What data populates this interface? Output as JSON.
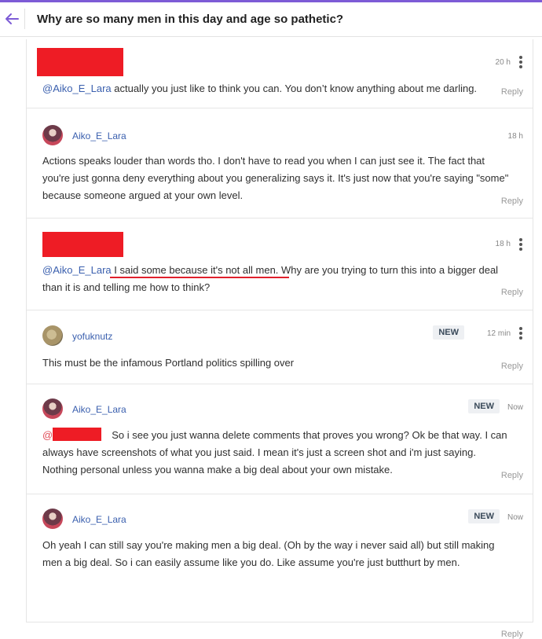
{
  "header": {
    "title": "Why are so many men in this day and age so pathetic?"
  },
  "comments": [
    {
      "time": "20 h",
      "mention": "@Aiko_E_Lara",
      "text": " actually you just like to think you can. You don’t know anything about me darling.",
      "reply": "Reply"
    },
    {
      "user": "Aiko_E_Lara",
      "time": "18 h",
      "text": "Actions speaks louder than words tho. I don't have to read you when I can just see it. The fact that you're just gonna deny everything about you generalizing says it. It's just now that you're saying \"some\" because someone argued at your own level.",
      "reply": "Reply"
    },
    {
      "time": "18 h",
      "mention": "@Aiko_E_Lara",
      "highlight": "I said some because it's not all men.",
      "text": " Why are you trying to turn this into a bigger deal than it is and telling me how to think?",
      "reply": "Reply"
    },
    {
      "user": "yofuknutz",
      "badge": "NEW",
      "time": "12 min",
      "text": "This must be the infamous Portland politics spilling over",
      "reply": "Reply"
    },
    {
      "user": "Aiko_E_Lara",
      "badge": "NEW",
      "time": "Now",
      "mention": "@",
      "text": "So i see you just wanna delete comments that proves you wrong? Ok be that way. I can always have screenshots of what you just said. I mean it's just a screen shot and i'm just saying. Nothing personal unless you wanna make a big deal about your own mistake.",
      "reply": "Reply"
    },
    {
      "user": "Aiko_E_Lara",
      "badge": "NEW",
      "time": "Now",
      "text": "Oh yeah I can still say you're making men a big deal. (Oh by the way i never said all) but still making men a big deal. So i can easily assume like you do. Like assume you're just butthurt by men.",
      "reply": "Reply"
    }
  ],
  "colors": {
    "accent": "#7d5bd6",
    "link": "#3a5fae",
    "redaction": "#ee1c25"
  }
}
